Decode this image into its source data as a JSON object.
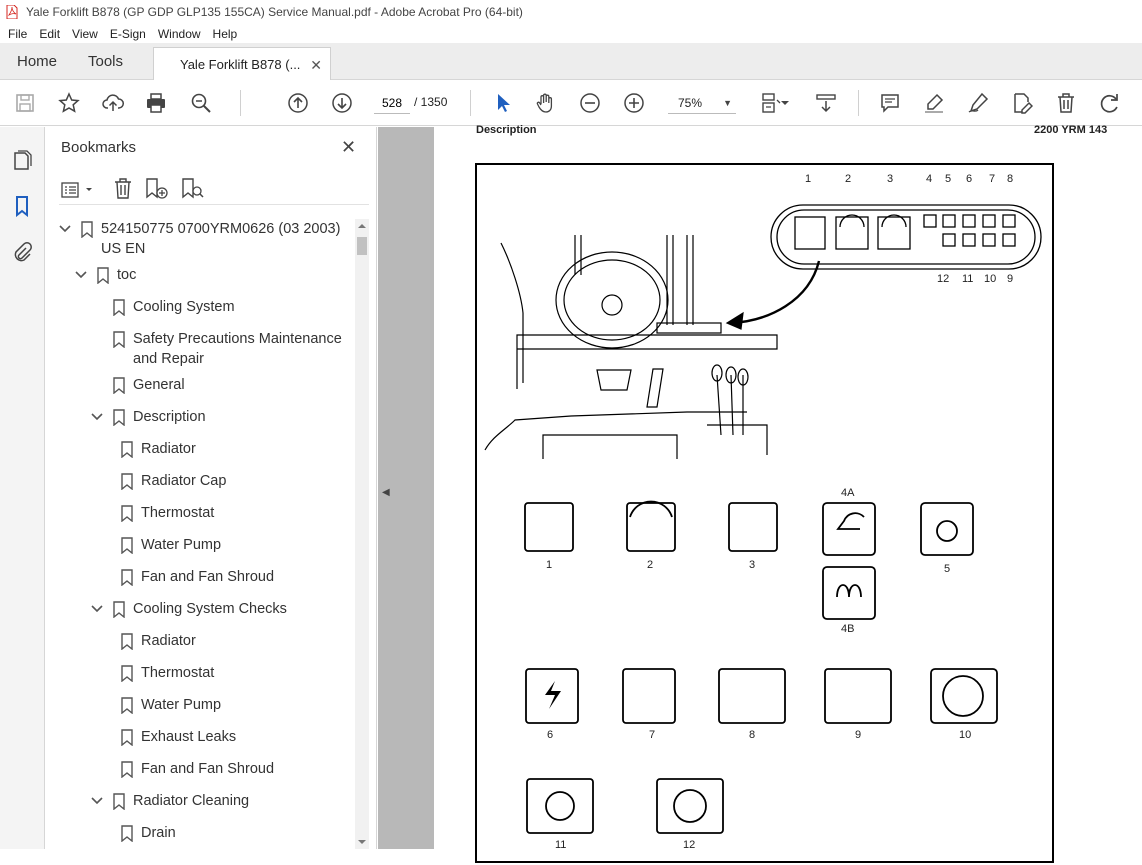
{
  "window": {
    "title": "Yale Forklift B878 (GP GDP GLP135 155CA) Service Manual.pdf - Adobe Acrobat Pro (64-bit)"
  },
  "menu": [
    "File",
    "Edit",
    "View",
    "E-Sign",
    "Window",
    "Help"
  ],
  "tabs": {
    "home": "Home",
    "tools": "Tools",
    "document": "Yale Forklift B878 (..."
  },
  "toolbar": {
    "page_current": "528",
    "page_total": "/  1350",
    "zoom": "75%"
  },
  "bookmarks": {
    "title": "Bookmarks",
    "items": [
      {
        "label": "524150775 0700YRM0626 (03 2003) US EN",
        "level": 0,
        "expanded": true
      },
      {
        "label": "toc",
        "level": 1,
        "expanded": true
      },
      {
        "label": "Cooling System",
        "level": 2
      },
      {
        "label": "Safety Precautions Maintenance and Repair",
        "level": 2
      },
      {
        "label": "General",
        "level": 2
      },
      {
        "label": "Description",
        "level": 2,
        "expanded": true
      },
      {
        "label": "Radiator",
        "level": 3
      },
      {
        "label": "Radiator Cap",
        "level": 3
      },
      {
        "label": "Thermostat",
        "level": 3
      },
      {
        "label": "Water Pump",
        "level": 3
      },
      {
        "label": "Fan and Fan Shroud",
        "level": 3
      },
      {
        "label": "Cooling System Checks",
        "level": 2,
        "expanded": true
      },
      {
        "label": "Radiator",
        "level": 3
      },
      {
        "label": "Thermostat",
        "level": 3
      },
      {
        "label": "Water Pump",
        "level": 3
      },
      {
        "label": "Exhaust Leaks",
        "level": 3
      },
      {
        "label": "Fan and Fan Shroud",
        "level": 3
      },
      {
        "label": "Radiator Cleaning",
        "level": 2,
        "expanded": true
      },
      {
        "label": "Drain",
        "level": 3
      }
    ]
  },
  "document": {
    "header_left": "Description",
    "header_right": "2200 YRM 143",
    "panel_callouts": [
      "1",
      "2",
      "3",
      "4",
      "5",
      "6",
      "7",
      "8",
      "12",
      "11",
      "10",
      "9"
    ],
    "symbol_labels": [
      "1",
      "2",
      "3",
      "4A",
      "5",
      "4B",
      "6",
      "7",
      "8",
      "9",
      "10",
      "11",
      "12"
    ]
  }
}
